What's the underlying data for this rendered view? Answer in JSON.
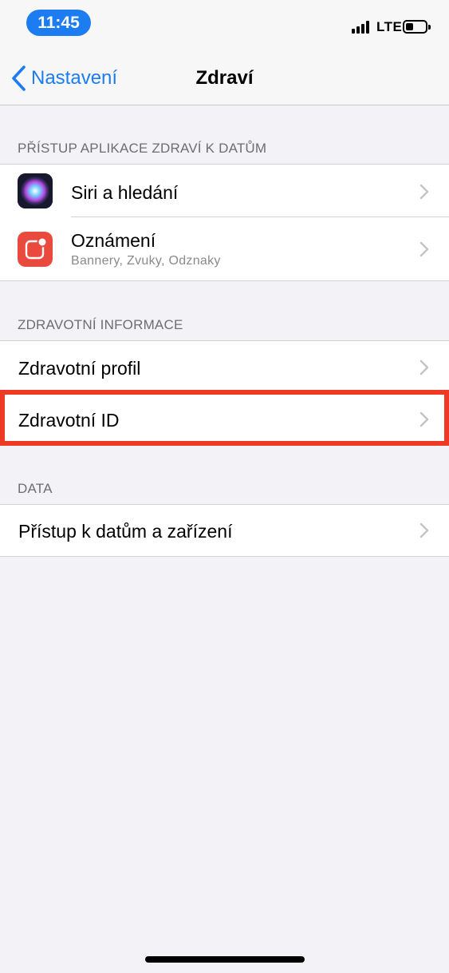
{
  "status_bar": {
    "time": "11:45",
    "network": "LTE"
  },
  "nav": {
    "back_label": "Nastavení",
    "title": "Zdraví"
  },
  "sections": {
    "app_access": {
      "header": "PŘÍSTUP APLIKACE ZDRAVÍ K DATŮM",
      "siri": {
        "title": "Siri a hledání",
        "icon": "siri-icon"
      },
      "notifications": {
        "title": "Oznámení",
        "subtitle": "Bannery, Zvuky, Odznaky",
        "icon": "notifications-icon"
      }
    },
    "health_info": {
      "header": "ZDRAVOTNÍ INFORMACE",
      "profile": {
        "title": "Zdravotní profil"
      },
      "medical_id": {
        "title": "Zdravotní ID",
        "highlighted": true
      }
    },
    "data": {
      "header": "DATA",
      "access": {
        "title": "Přístup k datům a zařízení"
      }
    }
  },
  "colors": {
    "accent": "#1d7cf4",
    "time_pill": "#1c7cf2",
    "highlight": "#ee3a25",
    "notifications_icon": "#ea4a3d",
    "background": "#f2f2f7"
  }
}
